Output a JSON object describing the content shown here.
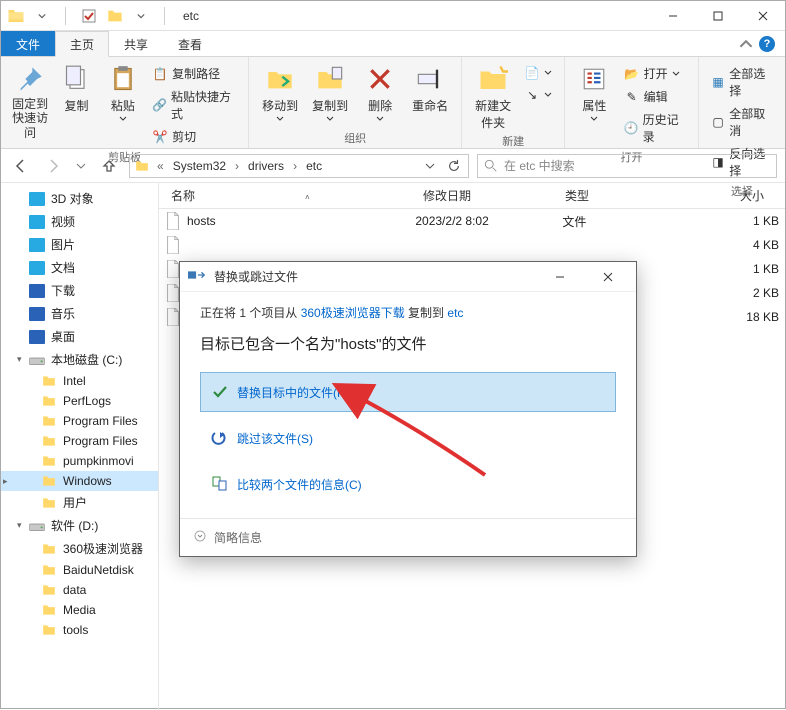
{
  "window": {
    "title": "etc"
  },
  "tabs": {
    "file": "文件",
    "home": "主页",
    "share": "共享",
    "view": "查看"
  },
  "ribbon": {
    "quickaccess": {
      "pin": "固定到快速访问"
    },
    "clipboard": {
      "copy": "复制",
      "paste": "粘贴",
      "copy_path": "复制路径",
      "paste_shortcut": "粘贴快捷方式",
      "cut": "剪切",
      "label": "剪贴板"
    },
    "organize": {
      "moveto": "移动到",
      "copyto": "复制到",
      "delete": "删除",
      "rename": "重命名",
      "label": "组织"
    },
    "new": {
      "newfolder": "新建文件夹",
      "label": "新建"
    },
    "open": {
      "properties": "属性",
      "open": "打开",
      "edit": "编辑",
      "history": "历史记录",
      "label": "打开"
    },
    "select": {
      "selectall": "全部选择",
      "selectnone": "全部取消",
      "invert": "反向选择",
      "label": "选择"
    }
  },
  "breadcrumb": {
    "seg1": "System32",
    "seg2": "drivers",
    "seg3": "etc"
  },
  "search": {
    "placeholder": "在 etc 中搜索"
  },
  "columns": {
    "name": "名称",
    "date": "修改日期",
    "type": "类型",
    "size": "大小"
  },
  "tree": {
    "items": [
      {
        "label": "3D 对象",
        "kind": "blue"
      },
      {
        "label": "视频",
        "kind": "pict"
      },
      {
        "label": "图片",
        "kind": "pict"
      },
      {
        "label": "文档",
        "kind": "doc"
      },
      {
        "label": "下载",
        "kind": "dl"
      },
      {
        "label": "音乐",
        "kind": "music"
      },
      {
        "label": "桌面",
        "kind": "desk"
      }
    ],
    "cdrive": {
      "label": "本地磁盘 (C:)"
    },
    "cdrive_children": [
      {
        "label": "Intel"
      },
      {
        "label": "PerfLogs"
      },
      {
        "label": "Program Files"
      },
      {
        "label": "Program Files"
      },
      {
        "label": "pumpkinmovi"
      },
      {
        "label": "Windows",
        "selected": true
      },
      {
        "label": "用户"
      }
    ],
    "ddrive": {
      "label": "软件 (D:)"
    },
    "ddrive_children": [
      {
        "label": "360极速浏览器"
      },
      {
        "label": "BaiduNetdisk"
      },
      {
        "label": "data"
      },
      {
        "label": "Media"
      },
      {
        "label": "tools"
      }
    ]
  },
  "files": [
    {
      "name": "hosts",
      "date": "2023/2/2 8:02",
      "type": "文件",
      "size": "1 KB"
    },
    {
      "name": "",
      "date": "",
      "type": "",
      "size": "4 KB"
    },
    {
      "name": "",
      "date": "",
      "type": "",
      "size": "1 KB"
    },
    {
      "name": "",
      "date": "",
      "type": "",
      "size": "2 KB"
    },
    {
      "name": "",
      "date": "",
      "type": "",
      "size": "18 KB"
    }
  ],
  "dialog": {
    "title": "替换或跳过文件",
    "copying_prefix": "正在将 1 个项目从 ",
    "copying_src": "360极速浏览器下载",
    "copying_mid": " 复制到 ",
    "copying_dst": "etc",
    "heading": "目标已包含一个名为\"hosts\"的文件",
    "opt_replace": "替换目标中的文件(R)",
    "opt_skip": "跳过该文件(S)",
    "opt_compare": "比较两个文件的信息(C)",
    "more": "简略信息"
  }
}
